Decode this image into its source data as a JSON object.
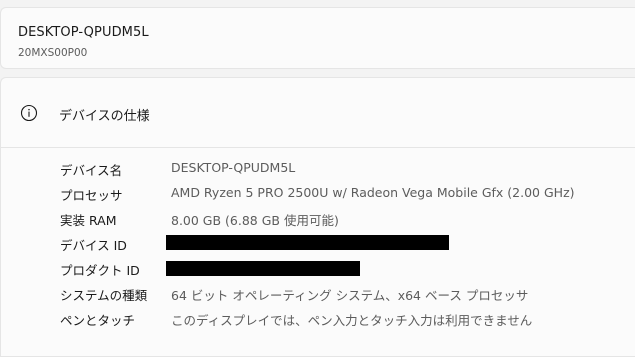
{
  "device": {
    "name": "DESKTOP-QPUDM5L",
    "model": "20MXS00P00"
  },
  "specs": {
    "title": "デバイスの仕様",
    "icon": "info-icon",
    "rows": [
      {
        "label": "デバイス名",
        "value": "DESKTOP-QPUDM5L"
      },
      {
        "label": "プロセッサ",
        "value": "AMD Ryzen 5 PRO 2500U w/ Radeon Vega Mobile Gfx   (2.00 GHz)"
      },
      {
        "label": "実装 RAM",
        "value": "8.00 GB (6.88 GB 使用可能)"
      },
      {
        "label": "デバイス ID",
        "value": ""
      },
      {
        "label": "プロダクト ID",
        "value": ""
      },
      {
        "label": "システムの種類",
        "value": "64 ビット オペレーティング システム、x64 ベース プロセッサ"
      },
      {
        "label": "ペンとタッチ",
        "value": "このディスプレイでは、ペン入力とタッチ入力は利用できません"
      }
    ]
  }
}
